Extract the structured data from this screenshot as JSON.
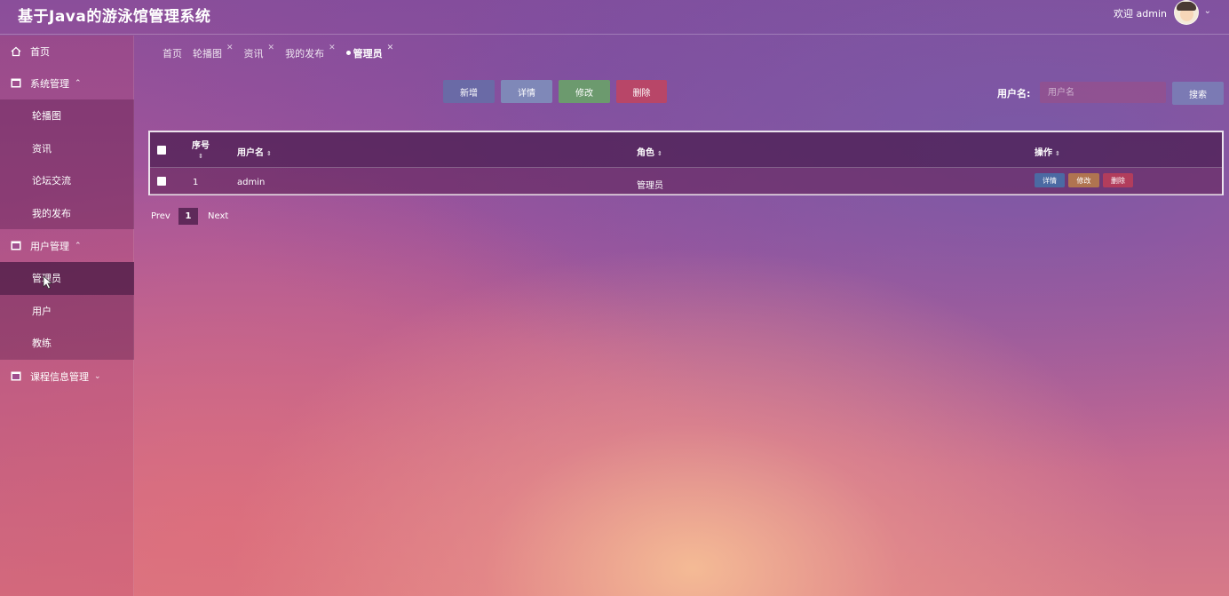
{
  "header": {
    "app_title": "基于Java的游泳馆管理系统",
    "welcome_text": "欢迎 admin"
  },
  "sidebar": {
    "home": "首页",
    "groups": [
      {
        "label": "系统管理",
        "items": [
          "轮播图",
          "资讯",
          "论坛交流",
          "我的发布"
        ]
      },
      {
        "label": "用户管理",
        "items": [
          "管理员",
          "用户",
          "教练"
        ]
      },
      {
        "label": "课程信息管理",
        "items": []
      }
    ]
  },
  "tabs": [
    {
      "label": "首页"
    },
    {
      "label": "轮播图"
    },
    {
      "label": "资讯"
    },
    {
      "label": "我的发布"
    },
    {
      "label": "管理员",
      "active": true
    }
  ],
  "toolbar": {
    "add": "新增",
    "detail": "详情",
    "edit": "修改",
    "delete": "删除",
    "search_label": "用户名:",
    "search_placeholder": "用户名",
    "search_value": "",
    "search_button": "搜索"
  },
  "table": {
    "columns": [
      "序号",
      "用户名",
      "角色",
      "操作"
    ],
    "rows": [
      {
        "index": "1",
        "username": "admin",
        "role": "管理员",
        "actions": [
          "详情",
          "修改",
          "删除"
        ]
      }
    ]
  },
  "pagination": {
    "prev": "Prev",
    "current": "1",
    "next": "Next"
  },
  "colors": {
    "add": "#6a6aa6",
    "detail": "#7f88b8",
    "edit": "#6c9a6e",
    "delete": "#b84668",
    "search": "#7b7ab4"
  },
  "icons": [
    "home-icon",
    "window-icon",
    "chevron-up-icon",
    "chevron-down-icon",
    "close-icon",
    "sort-icon",
    "cursor-icon",
    "avatar"
  ]
}
